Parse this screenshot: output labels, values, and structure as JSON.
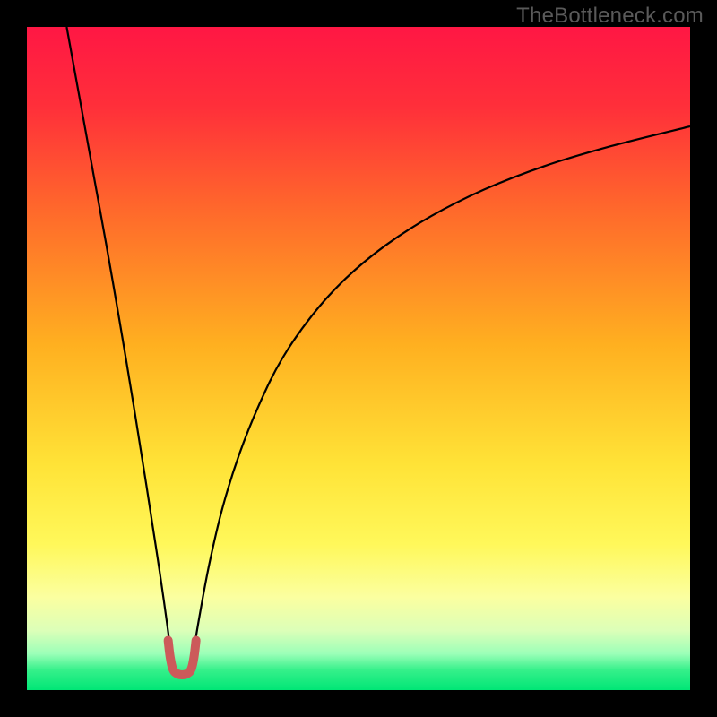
{
  "watermark": "TheBottleneck.com",
  "chart_data": {
    "type": "line",
    "title": "",
    "xlabel": "",
    "ylabel": "",
    "xlim": [
      0,
      100
    ],
    "ylim": [
      0,
      100
    ],
    "grid": false,
    "legend": false,
    "background_gradient_stops": [
      {
        "offset": 0.0,
        "color": "#ff1744"
      },
      {
        "offset": 0.12,
        "color": "#ff2f3a"
      },
      {
        "offset": 0.28,
        "color": "#ff6a2b"
      },
      {
        "offset": 0.48,
        "color": "#ffb020"
      },
      {
        "offset": 0.66,
        "color": "#ffe337"
      },
      {
        "offset": 0.78,
        "color": "#fff85a"
      },
      {
        "offset": 0.86,
        "color": "#fbffa0"
      },
      {
        "offset": 0.91,
        "color": "#dcffb8"
      },
      {
        "offset": 0.945,
        "color": "#9cffb8"
      },
      {
        "offset": 0.97,
        "color": "#35f08a"
      },
      {
        "offset": 1.0,
        "color": "#00e676"
      }
    ],
    "series": [
      {
        "name": "left-branch",
        "color": "#000000",
        "stroke_width": 2.2,
        "x": [
          6.0,
          8.0,
          10.0,
          12.0,
          14.0,
          16.0,
          18.0,
          19.0,
          20.0,
          21.0,
          21.8
        ],
        "y": [
          100.0,
          89.0,
          78.0,
          67.0,
          55.5,
          43.5,
          31.0,
          24.5,
          18.0,
          11.0,
          5.0
        ]
      },
      {
        "name": "right-branch",
        "color": "#000000",
        "stroke_width": 2.2,
        "x": [
          25.0,
          26.0,
          27.5,
          29.5,
          32.0,
          35.0,
          38.5,
          43.0,
          48.0,
          54.0,
          61.0,
          69.0,
          78.0,
          88.0,
          100.0
        ],
        "y": [
          5.0,
          11.0,
          19.0,
          27.5,
          35.5,
          43.0,
          50.0,
          56.5,
          62.0,
          67.0,
          71.5,
          75.5,
          79.0,
          82.0,
          85.0
        ]
      },
      {
        "name": "valley-marker",
        "color": "#cc5a5a",
        "stroke_width": 10,
        "linecap": "round",
        "x": [
          21.3,
          21.6,
          22.0,
          22.6,
          23.4,
          24.2,
          24.8,
          25.2,
          25.5
        ],
        "y": [
          7.5,
          5.0,
          3.2,
          2.5,
          2.3,
          2.5,
          3.2,
          5.0,
          7.5
        ]
      }
    ]
  }
}
